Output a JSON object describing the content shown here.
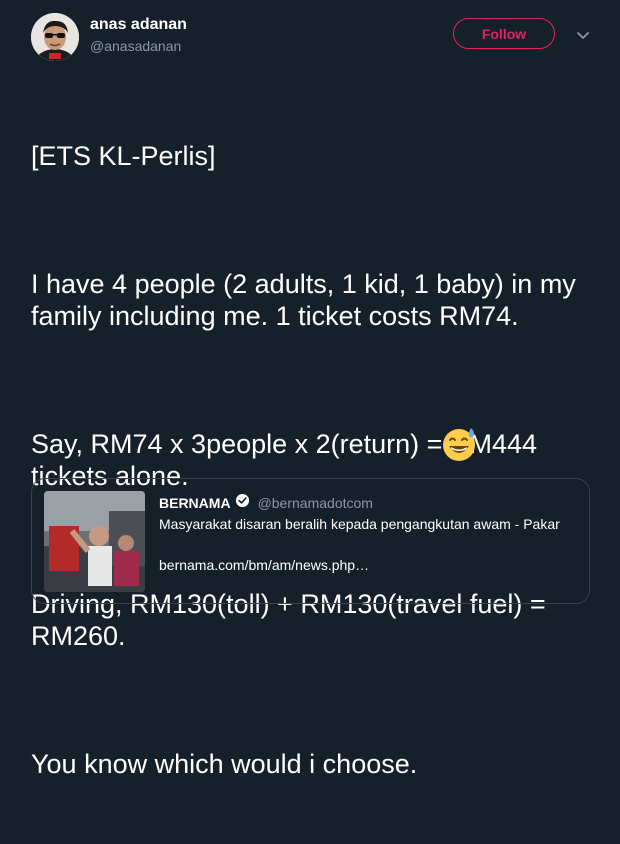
{
  "user": {
    "display_name": "anas adanan",
    "handle": "@anasadanan",
    "avatar_icon": "avatar-photo"
  },
  "follow_button": {
    "label": "Follow",
    "color": "#e0245e"
  },
  "menu": {
    "icon": "chevron-down-icon"
  },
  "tweet": {
    "paragraphs": [
      "[ETS KL-Perlis]",
      "I have 4 people (2 adults, 1 kid, 1 baby) in my family including me. 1 ticket costs RM74.",
      "Say, RM74 x 3people x 2(return) = RM444 tickets alone.",
      "Driving, RM130(toll) + RM130(travel fuel) = RM260.",
      "You know which would i choose."
    ],
    "emoji": "grinning-face-with-sweat"
  },
  "quoted": {
    "name": "BERNAMA",
    "verified_icon": "verified-badge-icon",
    "handle": "@bernamadotcom",
    "title": "Masyarakat disaran beralih kepada pengangkutan awam - Pakar",
    "link": "bernama.com/bm/am/news.php…",
    "thumbnail_icon": "news-photo"
  },
  "colors": {
    "background": "#15202b",
    "text": "#ffffff",
    "secondary": "#8899a6",
    "border": "#38444d",
    "accent": "#e0245e"
  }
}
